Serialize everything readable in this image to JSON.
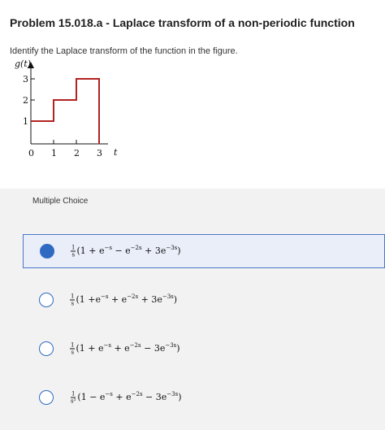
{
  "problem": {
    "title": "Problem 15.018.a - Laplace transform of a non-periodic function",
    "prompt": "Identify the Laplace transform of the function in the figure."
  },
  "figure": {
    "y_axis_label": "g(t)",
    "x_axis_label": "t",
    "y_ticks": [
      "1",
      "2",
      "3"
    ],
    "x_ticks": [
      "0",
      "1",
      "2",
      "3"
    ],
    "step_levels": [
      {
        "t_start": 0,
        "t_end": 1,
        "g": 1
      },
      {
        "t_start": 1,
        "t_end": 2,
        "g": 2
      },
      {
        "t_start": 2,
        "t_end": 3,
        "g": 3
      }
    ],
    "curve_color": "#b22222"
  },
  "question": {
    "type_label": "Multiple Choice",
    "selected_index": 0,
    "options": [
      {
        "frac_num": "1",
        "frac_den": "s",
        "p1": "(1 + e",
        "e1": "−s",
        "p2": " − e",
        "e2": "−2s",
        "p3": " + 3e",
        "e3": "−3s",
        "p4": ")"
      },
      {
        "frac_num": "1",
        "frac_den": "s",
        "p1": "(1 +e",
        "e1": "−s",
        "p2": " + e",
        "e2": "−2s",
        "p3": " + 3e",
        "e3": "−3s",
        "p4": ")"
      },
      {
        "frac_num": "1",
        "frac_den": "s",
        "p1": "(1 + e",
        "e1": "−s",
        "p2": " + e",
        "e2": "−2s",
        "p3": " − 3e",
        "e3": "−3s",
        "p4": ")"
      },
      {
        "frac_num": "1",
        "frac_den": "s²",
        "p1": "(1 − e",
        "e1": "−s",
        "p2": " + e",
        "e2": "−2s",
        "p3": " − 3e",
        "e3": "−3s",
        "p4": ")"
      }
    ]
  },
  "colors": {
    "accent": "#2f6ac2",
    "selected_bg": "#e9eef8",
    "panel_bg": "#f2f2f2"
  }
}
